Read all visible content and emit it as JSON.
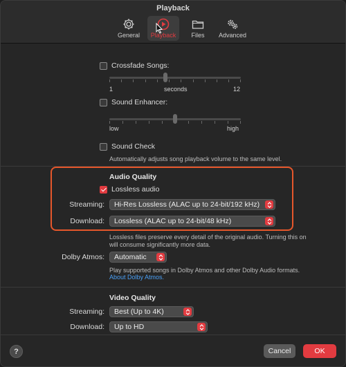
{
  "window": {
    "title": "Playback"
  },
  "tabs": [
    {
      "label": "General",
      "icon": "gear-icon"
    },
    {
      "label": "Playback",
      "icon": "play-circle-icon"
    },
    {
      "label": "Files",
      "icon": "folder-icon"
    },
    {
      "label": "Advanced",
      "icon": "gears-icon"
    }
  ],
  "active_tab": "Playback",
  "crossfade": {
    "label": "Crossfade Songs:",
    "checked": false,
    "min": "1",
    "mid": "seconds",
    "max": "12"
  },
  "enhancer": {
    "label": "Sound Enhancer:",
    "checked": false,
    "min": "low",
    "max": "high"
  },
  "sound_check": {
    "label": "Sound Check",
    "checked": false,
    "description": "Automatically adjusts song playback volume to the same level."
  },
  "audio_quality": {
    "heading": "Audio Quality",
    "lossless": {
      "label": "Lossless audio",
      "checked": true
    },
    "streaming_label": "Streaming:",
    "streaming_value": "Hi-Res Lossless (ALAC up to 24-bit/192 kHz)",
    "download_label": "Download:",
    "download_value": "Lossless (ALAC up to 24-bit/48 kHz)",
    "note_line1": "Lossless files preserve every detail of the original audio. Turning this on",
    "note_line2": "will consume significantly more data."
  },
  "dolby": {
    "label": "Dolby Atmos:",
    "value": "Automatic",
    "description": "Play supported songs in Dolby Atmos and other Dolby Audio formats.",
    "link": "About Dolby Atmos."
  },
  "video_quality": {
    "heading": "Video Quality",
    "streaming_label": "Streaming:",
    "streaming_value": "Best (Up to 4K)",
    "download_label": "Download:",
    "download_value": "Up to HD"
  },
  "footer": {
    "help": "?",
    "cancel": "Cancel",
    "ok": "OK"
  },
  "colors": {
    "accent": "#e23b40",
    "highlight": "#e7572b",
    "link": "#4a9ff5"
  }
}
